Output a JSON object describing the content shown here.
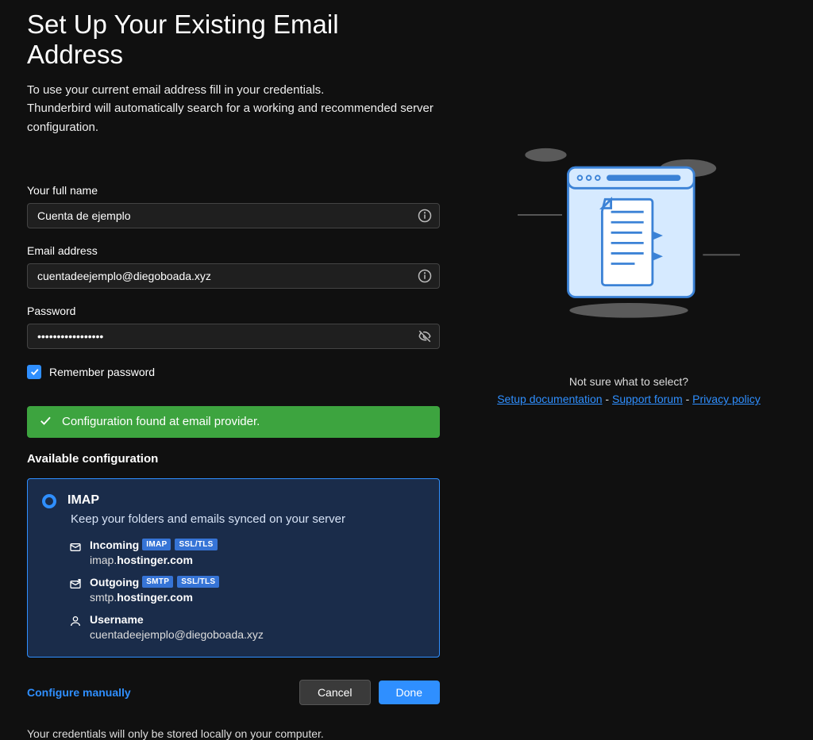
{
  "header": {
    "title": "Set Up Your Existing Email Address",
    "subtitle_line1": "To use your current email address fill in your credentials.",
    "subtitle_line2": "Thunderbird will automatically search for a working and recommended server configuration."
  },
  "form": {
    "full_name_label": "Your full name",
    "full_name_value": "Cuenta de ejemplo",
    "email_label": "Email address",
    "email_value": "cuentadeejemplo@diegoboada.xyz",
    "password_label": "Password",
    "password_value": "•••••••••••••••••",
    "remember_label": "Remember password"
  },
  "banner": {
    "text": "Configuration found at email provider."
  },
  "config": {
    "section_title": "Available configuration",
    "option_title": "IMAP",
    "option_desc": "Keep your folders and emails synced on your server",
    "incoming_label": "Incoming",
    "incoming_proto": "IMAP",
    "incoming_sec": "SSL/TLS",
    "incoming_host_prefix": "imap.",
    "incoming_host_main": "hostinger.com",
    "outgoing_label": "Outgoing",
    "outgoing_proto": "SMTP",
    "outgoing_sec": "SSL/TLS",
    "outgoing_host_prefix": "smtp.",
    "outgoing_host_main": "hostinger.com",
    "username_label": "Username",
    "username_value": "cuentadeejemplo@diegoboada.xyz"
  },
  "actions": {
    "configure_manually": "Configure manually",
    "cancel": "Cancel",
    "done": "Done"
  },
  "footer": {
    "note": "Your credentials will only be stored locally on your computer."
  },
  "help": {
    "prompt": "Not sure what to select?",
    "doc": "Setup documentation",
    "forum": "Support forum",
    "privacy": "Privacy policy",
    "sep": " - "
  }
}
